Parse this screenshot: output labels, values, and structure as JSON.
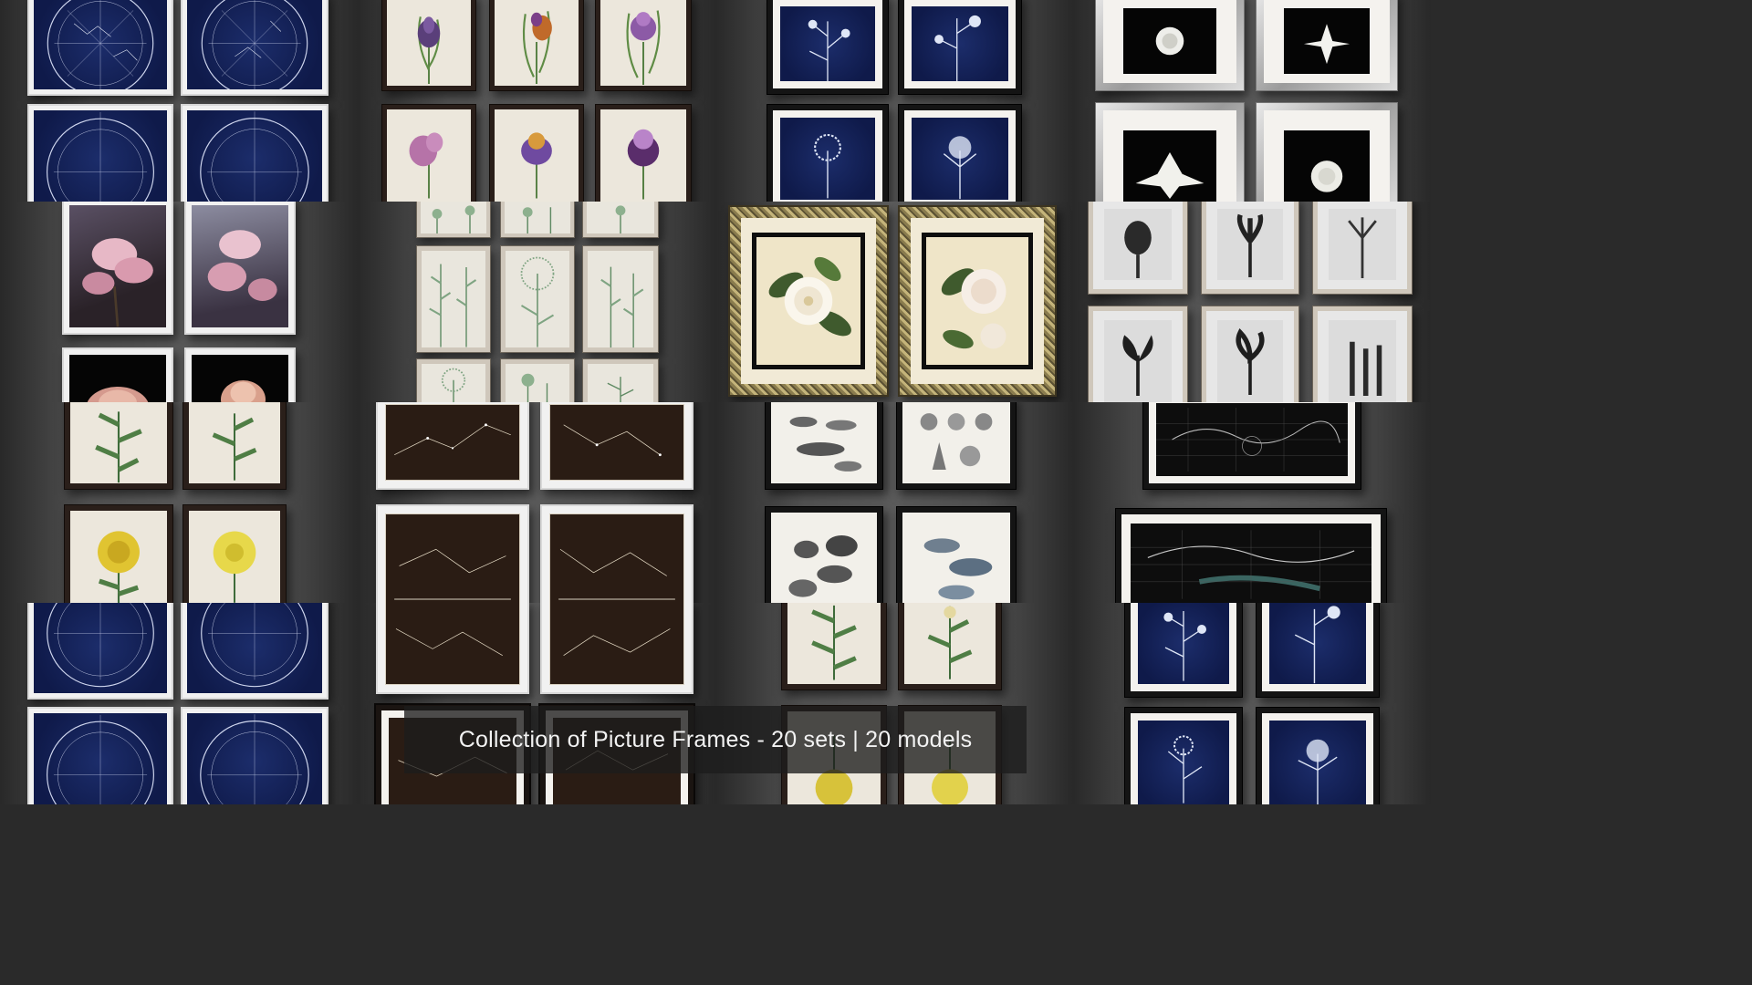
{
  "caption": "Collection of Picture Frames - 20 sets | 20 models",
  "colors": {
    "wall": "#4a4a4a",
    "caption_bg": "#1c1c1c",
    "caption_text": "#f2f2f2",
    "navy_print": "#13205a",
    "gold_frame": "#b8a86c"
  },
  "sets": [
    {
      "name": "celestial-chart-blue",
      "frame": "white",
      "art": "celestial"
    },
    {
      "name": "iris-botanical",
      "frame": "dark",
      "art": "iris"
    },
    {
      "name": "cyanotype-botanical",
      "frame": "black",
      "art": "cyanotype"
    },
    {
      "name": "white-flowers-on-black",
      "frame": "silver",
      "art": "whiteflower"
    },
    {
      "name": "magnolia-photo",
      "frame": "white",
      "art": "magnolia"
    },
    {
      "name": "green-herbal-plates",
      "frame": "thin",
      "art": "herbal"
    },
    {
      "name": "magnolia-gold-ornate",
      "frame": "gold",
      "art": "magnolia-painting"
    },
    {
      "name": "bw-botanical-photos",
      "frame": "thin",
      "art": "bwplant"
    },
    {
      "name": "tulip-photo",
      "frame": "white",
      "art": "tulip"
    },
    {
      "name": "chrysanthemum-green",
      "frame": "dark",
      "art": "chrysanthemum"
    },
    {
      "name": "chrysanthemum-yellow",
      "frame": "dark",
      "art": "chrysanthemum-yellow"
    },
    {
      "name": "dark-star-maps",
      "frame": "white",
      "art": "starmap"
    },
    {
      "name": "fish-and-shells",
      "frame": "black",
      "art": "fish"
    },
    {
      "name": "reptiles-and-fishes",
      "frame": "black",
      "art": "reptiles"
    },
    {
      "name": "world-map-small",
      "frame": "black",
      "art": "worldmap"
    },
    {
      "name": "world-map-wide",
      "frame": "black",
      "art": "worldmap-wide"
    },
    {
      "name": "celestial-chart-blue-2",
      "frame": "white",
      "art": "celestial"
    },
    {
      "name": "star-maps-dark-2",
      "frame": "white",
      "art": "starmap"
    },
    {
      "name": "chrysanthemum-green-2",
      "frame": "dark",
      "art": "chrysanthemum"
    },
    {
      "name": "cyanotype-botanical-2",
      "frame": "black",
      "art": "cyanotype"
    }
  ]
}
